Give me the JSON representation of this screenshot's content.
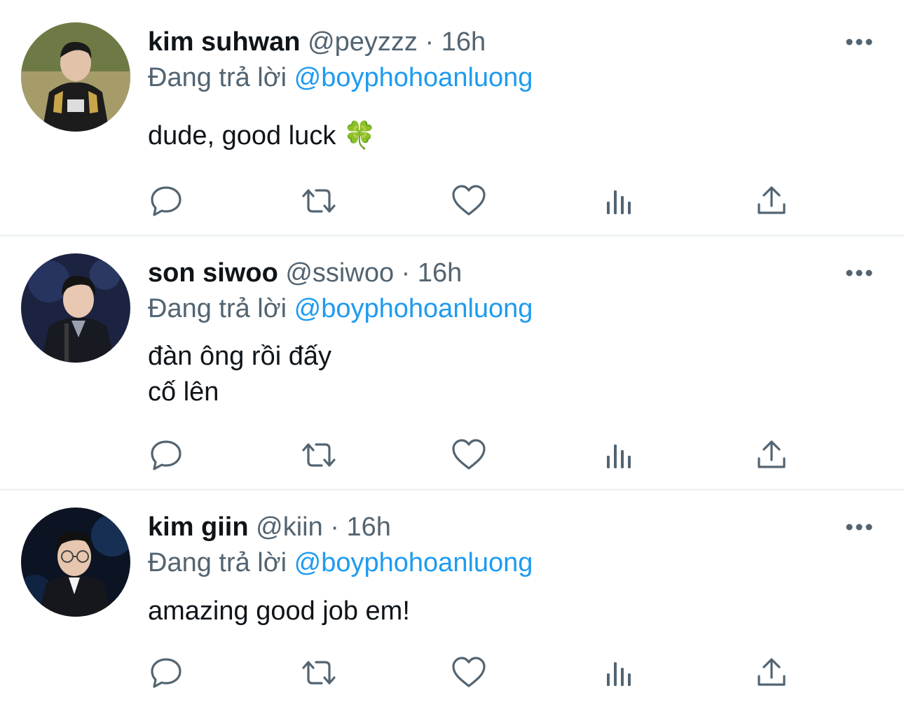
{
  "tweets": [
    {
      "display_name": "kim suhwan",
      "handle": "@peyzzz",
      "separator": "·",
      "time": "16h",
      "reply_prefix": "Đang trả lời",
      "reply_to": "@boyphohoanluong",
      "body_lines": [
        "dude, good luck"
      ],
      "body_emoji": "🍀",
      "avatar_desc": "player in black GEN jersey"
    },
    {
      "display_name": "son siwoo",
      "handle": "@ssiwoo",
      "separator": "·",
      "time": "16h",
      "reply_prefix": "Đang trả lời",
      "reply_to": "@boyphohoanluong",
      "body_lines": [
        "đàn ông rồi đấy",
        "cố lên"
      ],
      "avatar_desc": "man in suit at podium"
    },
    {
      "display_name": "kim giin",
      "handle": "@kiin",
      "separator": "·",
      "time": "16h",
      "reply_prefix": "Đang trả lời",
      "reply_to": "@boyphohoanluong",
      "body_lines": [
        "amazing good job em!"
      ],
      "avatar_desc": "man with glasses in suit"
    }
  ],
  "action_icons": [
    "reply-icon",
    "retweet-icon",
    "like-icon",
    "views-icon",
    "share-icon"
  ],
  "colors": {
    "text": "#0f1419",
    "muted": "#536471",
    "accent": "#1d9bf0",
    "divider": "#eff3f4"
  }
}
